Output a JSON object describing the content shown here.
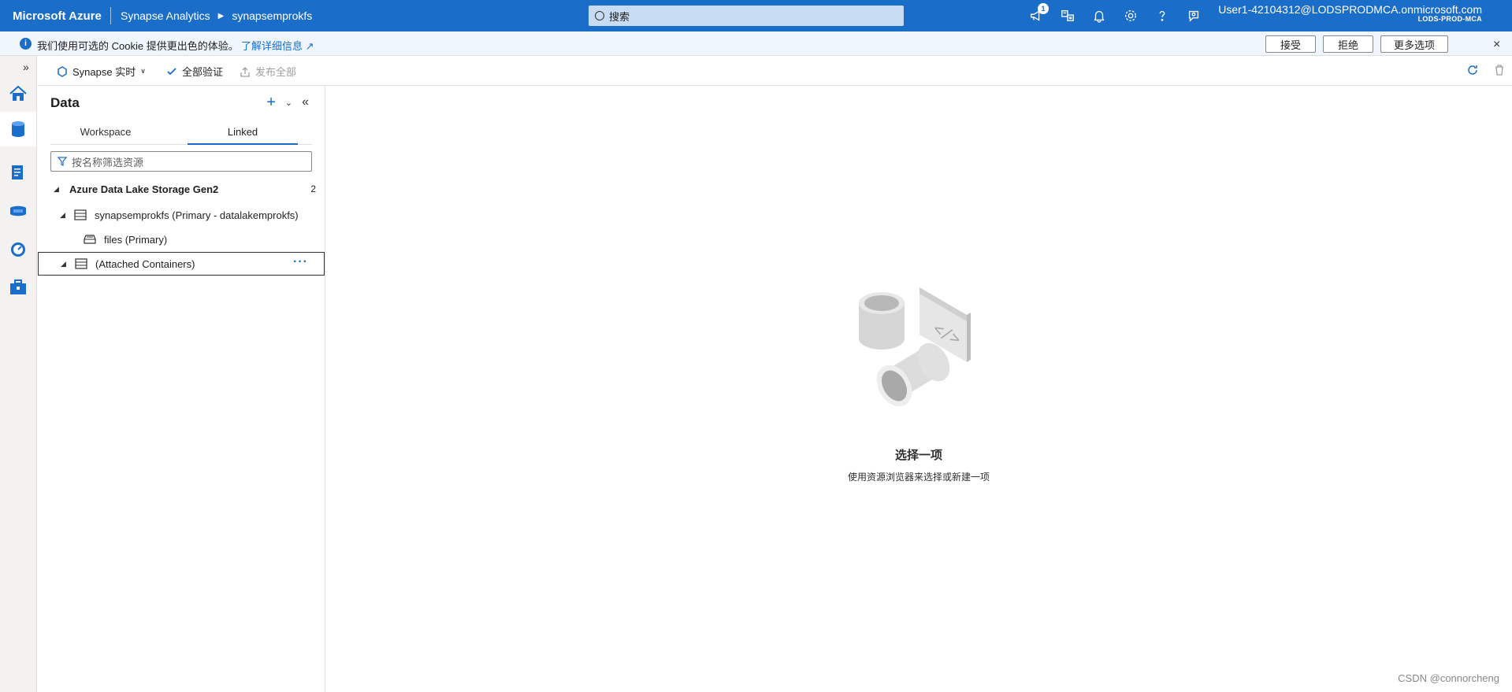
{
  "topbar": {
    "brand": "Microsoft Azure",
    "breadcrumb": [
      "Synapse Analytics",
      "synapsemprokfs"
    ],
    "search_placeholder": "搜索",
    "notification_count": "1",
    "user_name": "User1-42104312@LODSPRODMCA.onmicrosoft.com",
    "tenant": "LODS-PROD-MCA",
    "accent_color": "#1a6dc9"
  },
  "cookie": {
    "text": "我们使用可选的 Cookie 提供更出色的体验。",
    "link": "了解详细信息",
    "accept": "接受",
    "reject": "拒绝",
    "more": "更多选项",
    "close": "×"
  },
  "toolbar": {
    "synapse_live": "Synapse 实时",
    "validate_all": "全部验证",
    "publish_all": "发布全部"
  },
  "panel": {
    "title": "Data",
    "tabs": [
      {
        "label": "Workspace",
        "active": false
      },
      {
        "label": "Linked",
        "active": true
      }
    ],
    "filter_placeholder": "按名称筛选资源",
    "tree": [
      {
        "label": "Azure Data Lake Storage Gen2",
        "count": "2",
        "level": 0
      },
      {
        "label": "synapsemprokfs (Primary - datalakemprokfs)",
        "level": 1
      },
      {
        "label": "files (Primary)",
        "level": 2
      },
      {
        "label": "(Attached Containers)",
        "level": 1,
        "more": "···"
      }
    ]
  },
  "empty": {
    "title": "选择一项",
    "subtitle": "使用资源浏览器来选择或新建一项"
  },
  "watermark": "CSDN @connorcheng"
}
